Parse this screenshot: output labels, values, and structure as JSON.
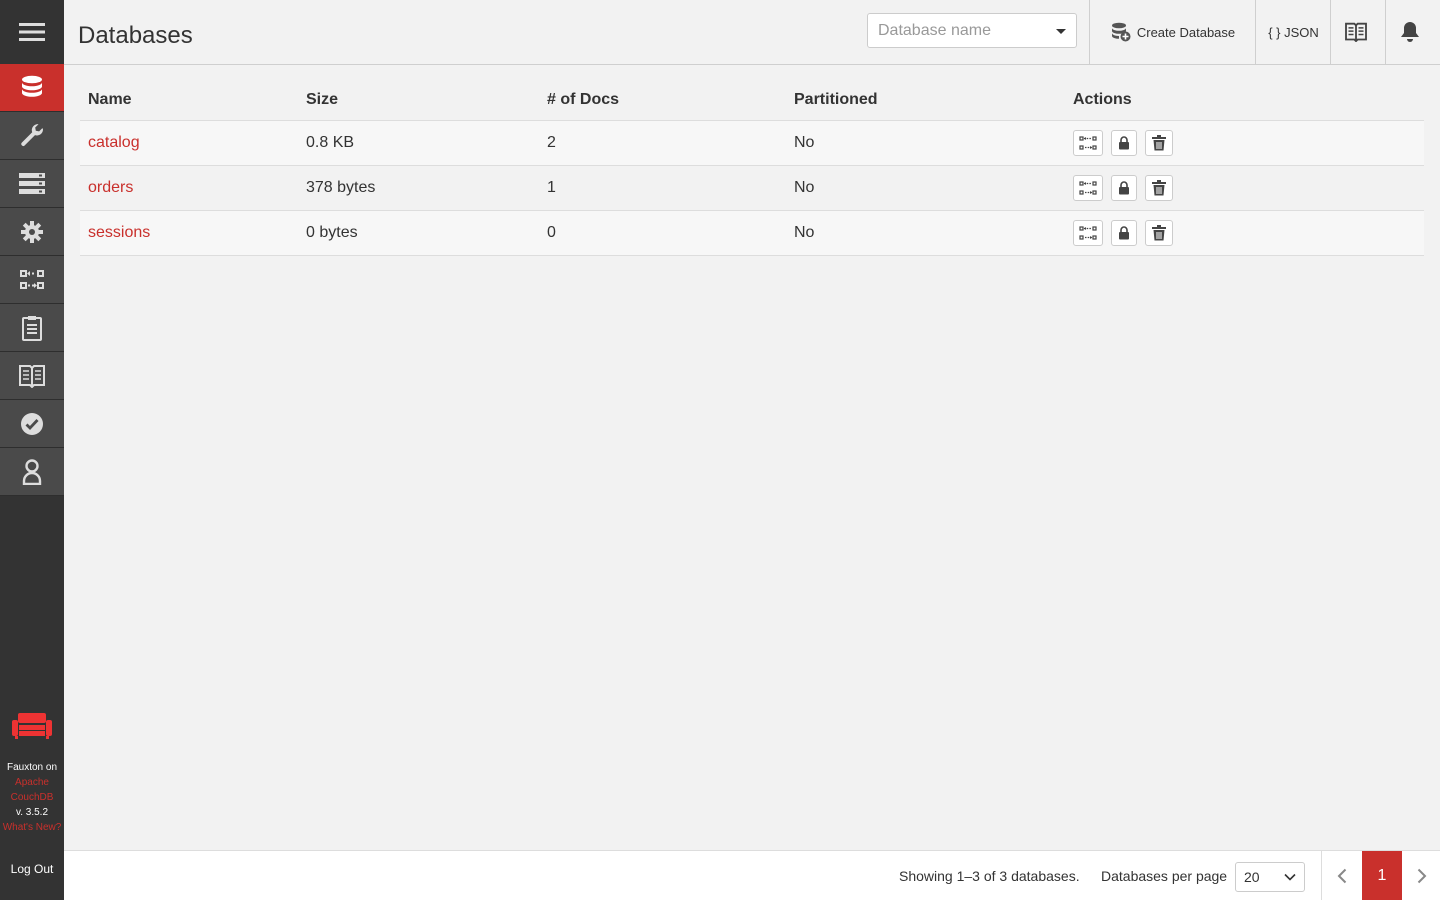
{
  "colors": {
    "accent": "#c9302c",
    "sidebar": "#333333",
    "sidebar_item": "#4a4a4a"
  },
  "header": {
    "title": "Databases",
    "search_placeholder": "Database name",
    "create_label": "Create Database",
    "json_label": "{ } JSON",
    "icons": [
      "docs-book-icon",
      "notification-bell-icon"
    ]
  },
  "sidebar": {
    "items": [
      {
        "name": "databases",
        "icon": "database-icon",
        "active": true
      },
      {
        "name": "setup",
        "icon": "wrench-icon"
      },
      {
        "name": "active-tasks",
        "icon": "tasks-icon"
      },
      {
        "name": "config",
        "icon": "gear-icon"
      },
      {
        "name": "replication",
        "icon": "replication-icon"
      },
      {
        "name": "nodes",
        "icon": "clipboard-icon"
      },
      {
        "name": "documentation",
        "icon": "book-icon"
      },
      {
        "name": "verify",
        "icon": "check-circle-icon"
      },
      {
        "name": "user",
        "icon": "user-icon"
      }
    ],
    "footer": {
      "line1": "Fauxton on",
      "line2": "Apache",
      "line3": "CouchDB",
      "version": "v. 3.5.2",
      "whats_new": "What's New?"
    },
    "logout": "Log Out"
  },
  "table": {
    "headers": {
      "name": "Name",
      "size": "Size",
      "docs": "# of Docs",
      "partitioned": "Partitioned",
      "actions": "Actions"
    },
    "rows": [
      {
        "name": "catalog",
        "size": "0.8 KB",
        "docs": "2",
        "partitioned": "No"
      },
      {
        "name": "orders",
        "size": "378 bytes",
        "docs": "1",
        "partitioned": "No"
      },
      {
        "name": "sessions",
        "size": "0 bytes",
        "docs": "0",
        "partitioned": "No"
      }
    ]
  },
  "footer": {
    "showing": "Showing 1–3 of 3 databases.",
    "per_page_label": "Databases per page",
    "per_page_value": "20",
    "current_page": "1"
  }
}
